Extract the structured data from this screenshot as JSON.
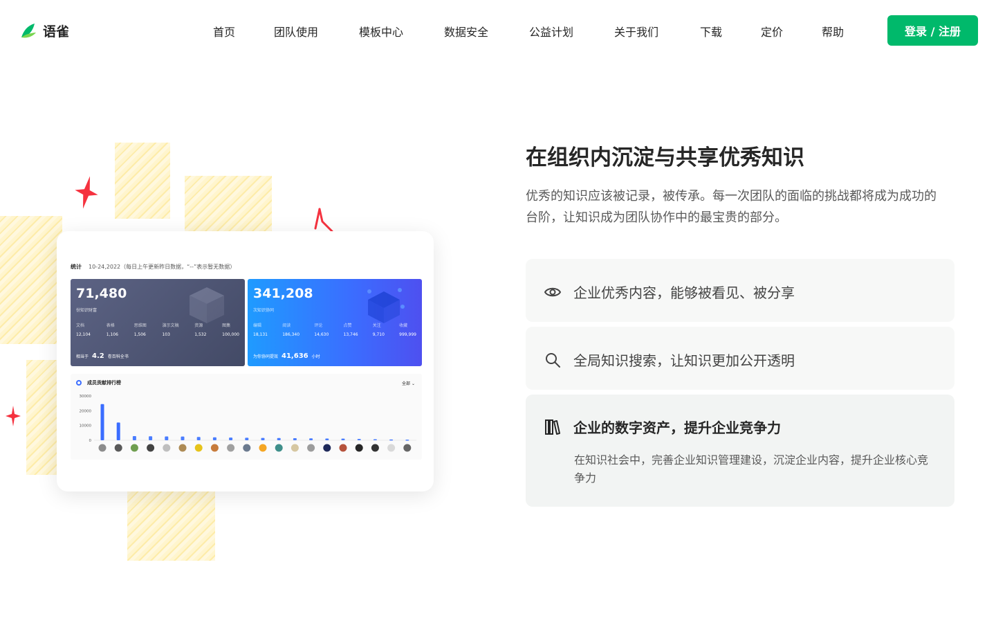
{
  "brand": {
    "name": "语雀",
    "accent": "#00b96b"
  },
  "nav": [
    {
      "label": "首页"
    },
    {
      "label": "团队使用"
    },
    {
      "label": "模板中心"
    },
    {
      "label": "数据安全"
    },
    {
      "label": "公益计划"
    },
    {
      "label": "关于我们"
    },
    {
      "label": "下载"
    },
    {
      "label": "定价"
    },
    {
      "label": "帮助"
    }
  ],
  "login": {
    "label": "登录 / 注册"
  },
  "dashboard": {
    "header": {
      "label": "统计",
      "date": "10-24,2022（每日上午更新昨日数据，“--”表示暂无数据）"
    },
    "panel1": {
      "value": "71,480",
      "sub": "份知识财富",
      "stats": [
        {
          "label": "文档",
          "value": "12,104"
        },
        {
          "label": "表格",
          "value": "1,106"
        },
        {
          "label": "思维图",
          "value": "1,506"
        },
        {
          "label": "演示文稿",
          "value": "103"
        },
        {
          "label": "资源",
          "value": "1,532"
        },
        {
          "label": "图集",
          "value": "100,000"
        }
      ],
      "foot_pre": "相当于",
      "foot_value": "4.2",
      "foot_post": "卷百科全书"
    },
    "panel2": {
      "value": "341,208",
      "sub": "次知识协同",
      "stats": [
        {
          "label": "编辑",
          "value": "18,131"
        },
        {
          "label": "阅读",
          "value": "186,340"
        },
        {
          "label": "评论",
          "value": "14,630"
        },
        {
          "label": "点赞",
          "value": "13,746"
        },
        {
          "label": "关注",
          "value": "9,710"
        },
        {
          "label": "收藏",
          "value": "999,999"
        }
      ],
      "foot_pre": "为你协同提效",
      "foot_value": "41,636",
      "foot_post": "小时"
    },
    "ranking": {
      "title": "成员贡献排行榜",
      "filter": "全部",
      "yticks": [
        "30000",
        "20000",
        "10000",
        "0"
      ],
      "values": [
        24500,
        12000,
        2800,
        2700,
        2600,
        2500,
        2200,
        2000,
        1800,
        1700,
        1600,
        1500,
        1400,
        1300,
        1200,
        1100,
        900,
        700,
        500,
        400
      ]
    }
  },
  "main": {
    "title": "在组织内沉淀与共享优秀知识",
    "desc": "优秀的知识应该被记录，被传承。每一次团队的面临的挑战都将成为成功的台阶，让知识成为团队协作中的最宝贵的部分。"
  },
  "features": [
    {
      "icon": "eye-icon",
      "label": "企业优秀内容，能够被看见、被分享"
    },
    {
      "icon": "search-icon",
      "label": "全局知识搜索，让知识更加公开透明"
    },
    {
      "icon": "library-icon",
      "label": "企业的数字资产，提升企业竞争力",
      "desc": "在知识社会中，完善企业知识管理建设，沉淀企业内容，提升企业核心竞争力"
    }
  ]
}
